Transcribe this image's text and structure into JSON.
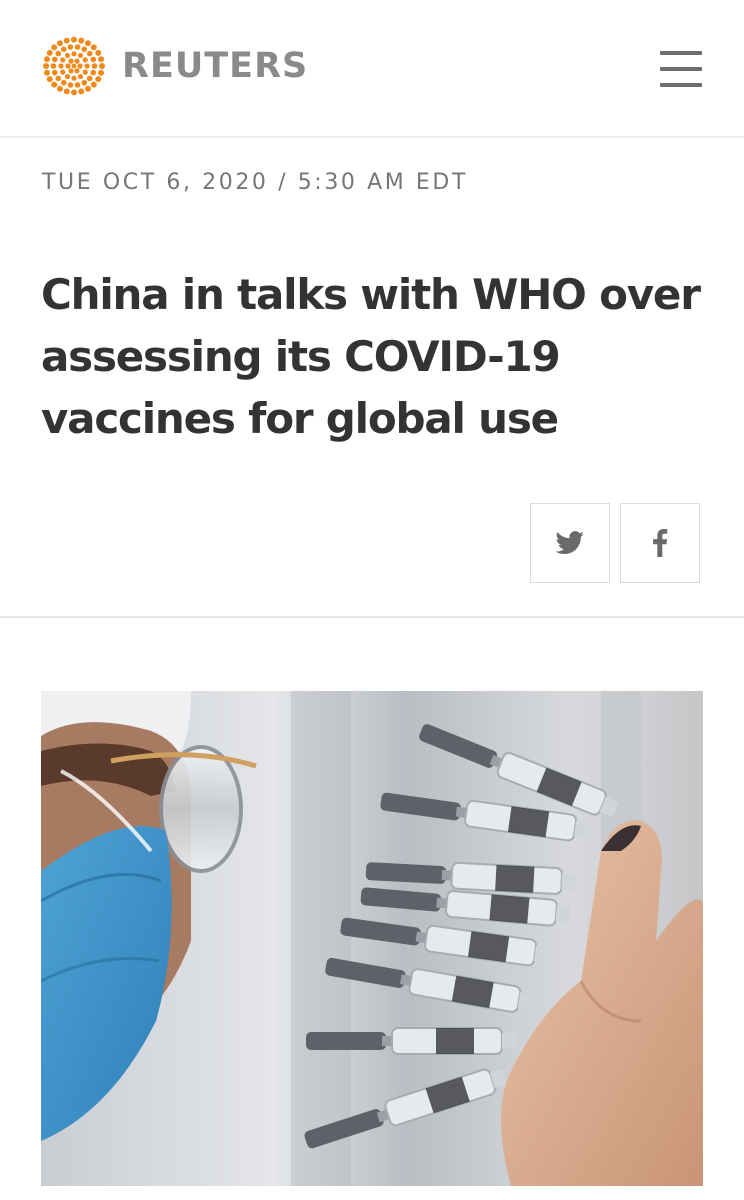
{
  "header": {
    "brand": "REUTERS",
    "brand_color": "#f08a1c",
    "logo_icon": "reuters-dot-logo-icon",
    "menu_icon": "hamburger-menu-icon"
  },
  "article": {
    "dateline": "TUE OCT 6, 2020 / 5:30 AM EDT",
    "headline": "China in talks with WHO over assessing its COVID-19 vaccines for global use"
  },
  "share": {
    "twitter_icon": "twitter-bird-icon",
    "facebook_icon": "facebook-f-icon"
  },
  "photo": {
    "subject": "lead-photo"
  }
}
